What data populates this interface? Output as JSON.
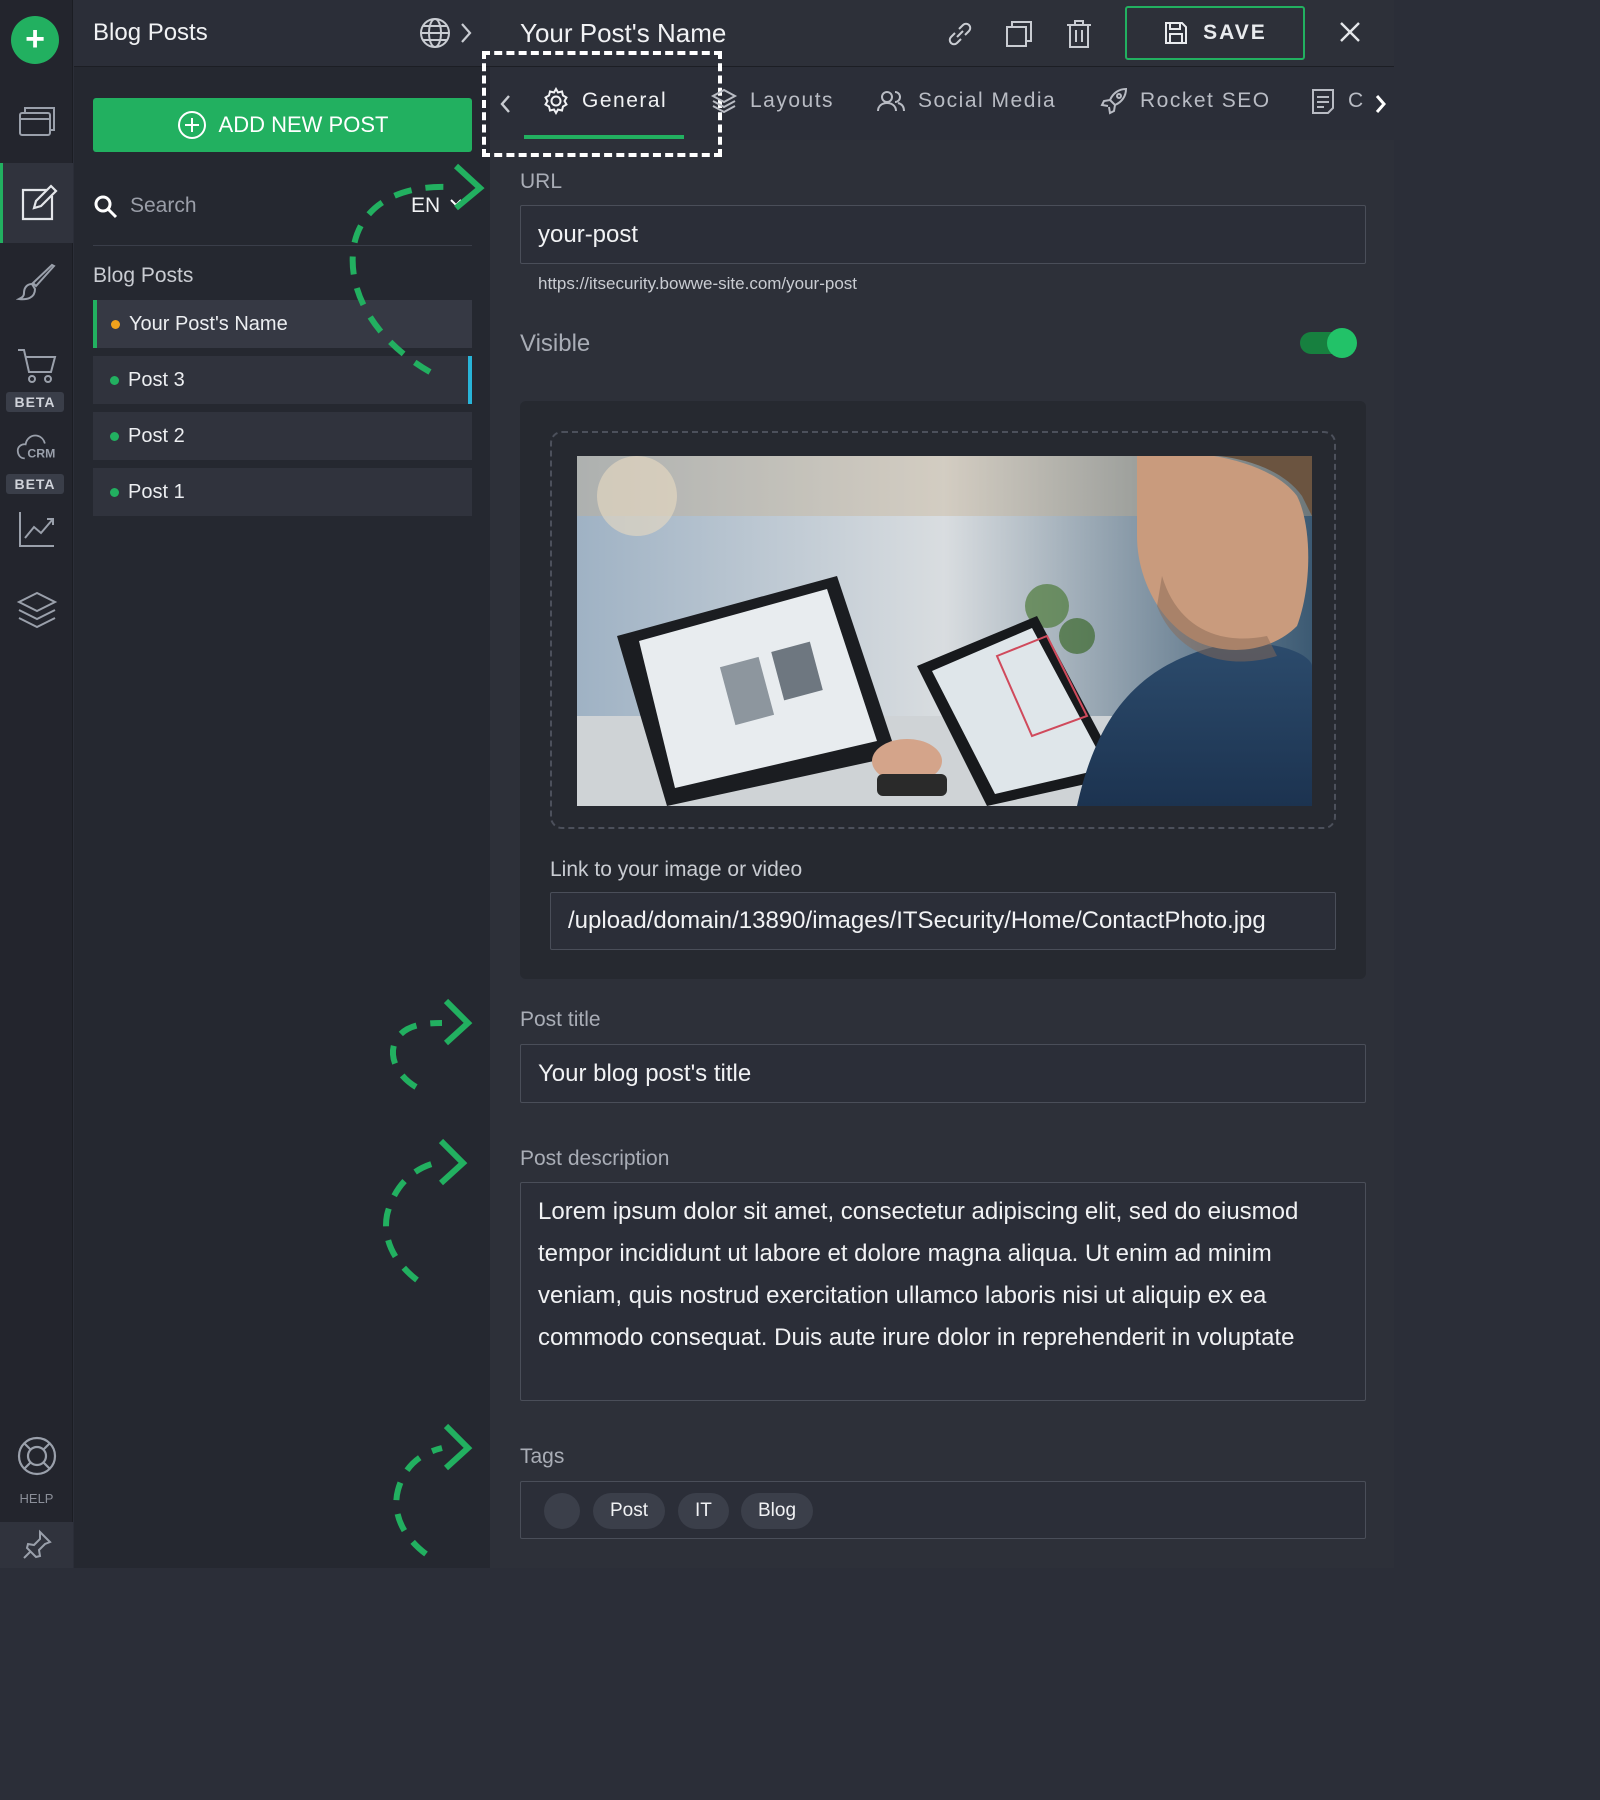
{
  "rail": {
    "beta_label_1": "BETA",
    "beta_label_2": "BETA",
    "crm_label": "CRM",
    "help_label": "HELP"
  },
  "sidebar": {
    "title": "Blog Posts",
    "add_button_label": "ADD NEW POST",
    "search_placeholder": "Search",
    "language": "EN",
    "section_title": "Blog Posts",
    "posts": [
      {
        "label": "Your Post's Name"
      },
      {
        "label": "Post 3"
      },
      {
        "label": "Post 2"
      },
      {
        "label": "Post 1"
      }
    ]
  },
  "header": {
    "title": "Your Post's Name",
    "save_label": "SAVE"
  },
  "tabs": [
    {
      "label": "General"
    },
    {
      "label": "Layouts"
    },
    {
      "label": "Social Media"
    },
    {
      "label": "Rocket SEO"
    },
    {
      "label": "C"
    }
  ],
  "form": {
    "url_label": "URL",
    "url_value": "your-post",
    "url_full": "https://itsecurity.bowwe-site.com/your-post",
    "visible_label": "Visible",
    "visible_on": true,
    "media_label": "Link to your image or video",
    "media_value": "/upload/domain/13890/images/ITSecurity/Home/ContactPhoto.jpg",
    "post_title_label": "Post title",
    "post_title_value": "Your blog post's title",
    "post_desc_label": "Post description",
    "post_desc_value": "Lorem ipsum dolor sit amet, consectetur adipiscing elit, sed do eiusmod tempor incididunt ut labore et dolore magna aliqua. Ut enim ad minim veniam, quis nostrud exercitation ullamco laboris nisi ut aliquip ex ea commodo consequat. Duis aute irure dolor in reprehenderit in voluptate",
    "tags_label": "Tags",
    "tags": [
      "Post",
      "IT",
      "Blog"
    ]
  },
  "colors": {
    "accent": "#22b060",
    "current_post_dot": "#f0a21c",
    "hover_indicator": "#28b4d8",
    "background": "#2d3039"
  }
}
